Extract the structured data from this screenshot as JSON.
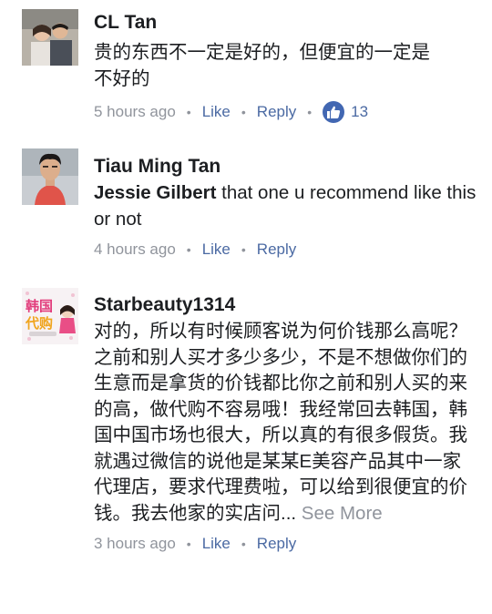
{
  "comments": [
    {
      "author": "CL Tan",
      "text_lines": [
        "贵的东西不一定是好的，但便宜的一定是",
        "不好的"
      ],
      "time": "5 hours ago",
      "like_label": "Like",
      "reply_label": "Reply",
      "reaction_icon": "thumbs-up-icon",
      "reaction_count": "13"
    },
    {
      "author": "Tiau Ming Tan",
      "mention": "Jessie Gilbert",
      "text_after_mention": " that one u recommend like this or not",
      "time": "4 hours ago",
      "like_label": "Like",
      "reply_label": "Reply"
    },
    {
      "author": "Starbeauty1314",
      "text": "对的，所以有时候顾客说为何价钱那么高呢？之前和别人买才多少多少，不是不想做你们的生意而是拿货的价钱都比你之前和别人买的来的高，做代购不容易哦！我经常回去韩国，韩国中国市场也很大，所以真的有很多假货。我就遇过微信的说他是某某E美容产品其中一家代理店，要求代理费啦，可以给到很便宜的价钱。我去他家的实店问...",
      "see_more": " See More",
      "time": "3 hours ago",
      "like_label": "Like",
      "reply_label": "Reply",
      "avatar_text_top": "韩国",
      "avatar_text_bottom": "代购"
    }
  ],
  "colors": {
    "text": "#1c1e21",
    "meta": "#90949c",
    "link": "#4b6aa3",
    "like_badge": "#4267b2"
  }
}
